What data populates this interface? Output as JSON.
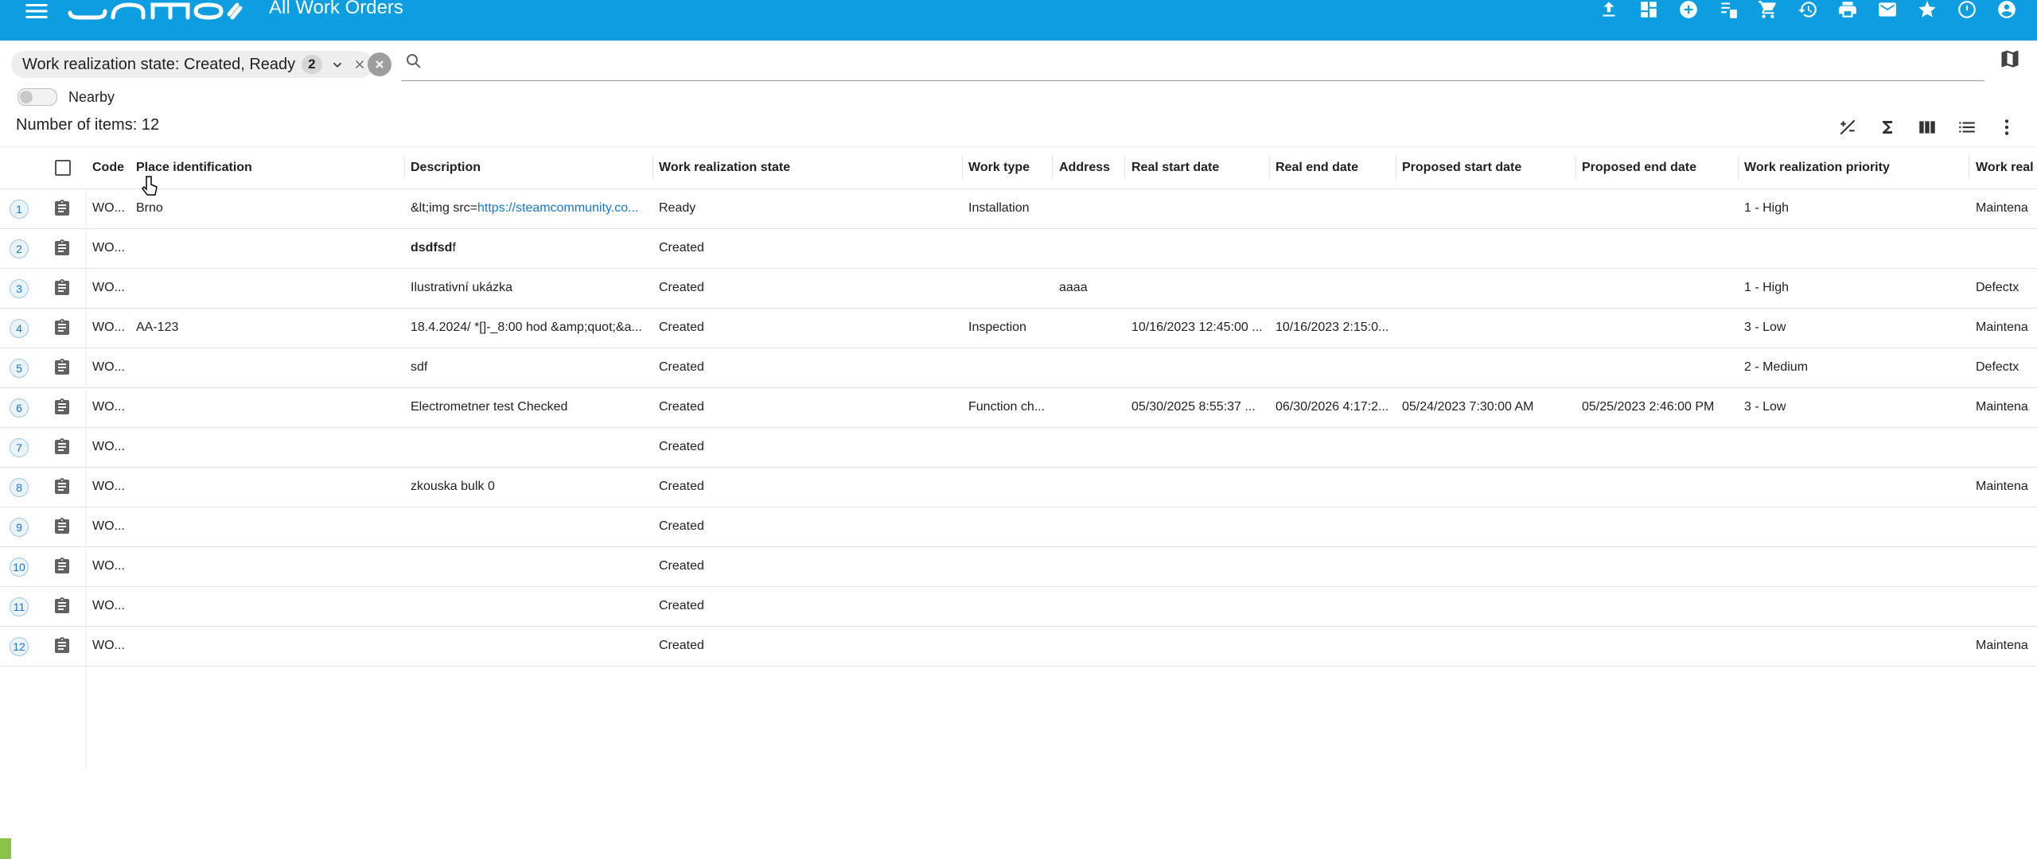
{
  "app": {
    "title": "All Work Orders",
    "logo_text": "SAMO"
  },
  "topbar_icons": [
    "upload-icon",
    "dashboard-icon",
    "add-circle-icon",
    "assignment-list-icon",
    "cart-icon",
    "history-icon",
    "print-icon",
    "mail-icon",
    "star-icon",
    "timer-icon",
    "account-icon"
  ],
  "filter": {
    "chip_label": "Work realization state: Created, Ready",
    "chip_count": "2",
    "search_placeholder": ""
  },
  "nearby_label": "Nearby",
  "items_label": "Number of items: 12",
  "toolbar_icons": [
    "plus-minus-icon",
    "sum-icon",
    "columns-icon",
    "list-icon",
    "more-vert-icon"
  ],
  "columns": {
    "code": "Code",
    "place": "Place identification",
    "description": "Description",
    "state": "Work realization state",
    "work_type": "Work type",
    "address": "Address",
    "real_start": "Real start date",
    "real_end": "Real end date",
    "proposed_start": "Proposed start date",
    "proposed_end": "Proposed end date",
    "priority": "Work realization priority",
    "work_real": "Work real"
  },
  "rows": [
    {
      "num": "1",
      "code": "WO...",
      "place": "Brno",
      "desc_pre": "&lt;img src=",
      "desc_link": "https://steamcommunity.co...",
      "desc_bold": "",
      "desc_rest": "",
      "state": "Ready",
      "work_type": "Installation",
      "address": "",
      "real_start": "",
      "real_end": "",
      "proposed_start": "",
      "proposed_end": "",
      "priority": "1 - High",
      "work_real": "Maintena"
    },
    {
      "num": "2",
      "code": "WO...",
      "place": "",
      "desc_pre": "",
      "desc_link": "",
      "desc_bold": "dsdfsd",
      "desc_rest": "f",
      "state": "Created",
      "work_type": "",
      "address": "",
      "real_start": "",
      "real_end": "",
      "proposed_start": "",
      "proposed_end": "",
      "priority": "",
      "work_real": ""
    },
    {
      "num": "3",
      "code": "WO...",
      "place": "",
      "desc_pre": "Ilustrativní ukázka",
      "desc_link": "",
      "desc_bold": "",
      "desc_rest": "",
      "state": "Created",
      "work_type": "",
      "address": "aaaa",
      "real_start": "",
      "real_end": "",
      "proposed_start": "",
      "proposed_end": "",
      "priority": "1 - High",
      "work_real": "Defectx"
    },
    {
      "num": "4",
      "code": "WO...",
      "place": "AA-123",
      "desc_pre": "18.4.2024/ *[]-_8:00 hod &amp;quot;&a...",
      "desc_link": "",
      "desc_bold": "",
      "desc_rest": "",
      "state": "Created",
      "work_type": "Inspection",
      "address": "",
      "real_start": "10/16/2023 12:45:00 ...",
      "real_end": "10/16/2023 2:15:0...",
      "proposed_start": "",
      "proposed_end": "",
      "priority": "3 - Low",
      "work_real": "Maintena"
    },
    {
      "num": "5",
      "code": "WO...",
      "place": "",
      "desc_pre": "sdf",
      "desc_link": "",
      "desc_bold": "",
      "desc_rest": "",
      "state": "Created",
      "work_type": "",
      "address": "",
      "real_start": "",
      "real_end": "",
      "proposed_start": "",
      "proposed_end": "",
      "priority": "2 - Medium",
      "work_real": "Defectx"
    },
    {
      "num": "6",
      "code": "WO...",
      "place": "",
      "desc_pre": "Electrometner test Checked",
      "desc_link": "",
      "desc_bold": "",
      "desc_rest": "",
      "state": "Created",
      "work_type": "Function ch...",
      "address": "",
      "real_start": "05/30/2025 8:55:37 ...",
      "real_end": "06/30/2026 4:17:2...",
      "proposed_start": "05/24/2023 7:30:00 AM",
      "proposed_end": "05/25/2023 2:46:00 PM",
      "priority": "3 - Low",
      "work_real": "Maintena"
    },
    {
      "num": "7",
      "code": "WO...",
      "place": "",
      "desc_pre": "",
      "desc_link": "",
      "desc_bold": "",
      "desc_rest": "",
      "state": "Created",
      "work_type": "",
      "address": "",
      "real_start": "",
      "real_end": "",
      "proposed_start": "",
      "proposed_end": "",
      "priority": "",
      "work_real": ""
    },
    {
      "num": "8",
      "code": "WO...",
      "place": "",
      "desc_pre": "zkouska bulk 0",
      "desc_link": "",
      "desc_bold": "",
      "desc_rest": "",
      "state": "Created",
      "work_type": "",
      "address": "",
      "real_start": "",
      "real_end": "",
      "proposed_start": "",
      "proposed_end": "",
      "priority": "",
      "work_real": "Maintena"
    },
    {
      "num": "9",
      "code": "WO...",
      "place": "",
      "desc_pre": "",
      "desc_link": "",
      "desc_bold": "",
      "desc_rest": "",
      "state": "Created",
      "work_type": "",
      "address": "",
      "real_start": "",
      "real_end": "",
      "proposed_start": "",
      "proposed_end": "",
      "priority": "",
      "work_real": ""
    },
    {
      "num": "10",
      "code": "WO...",
      "place": "",
      "desc_pre": "",
      "desc_link": "",
      "desc_bold": "",
      "desc_rest": "",
      "state": "Created",
      "work_type": "",
      "address": "",
      "real_start": "",
      "real_end": "",
      "proposed_start": "",
      "proposed_end": "",
      "priority": "",
      "work_real": ""
    },
    {
      "num": "11",
      "code": "WO...",
      "place": "",
      "desc_pre": "",
      "desc_link": "",
      "desc_bold": "",
      "desc_rest": "",
      "state": "Created",
      "work_type": "",
      "address": "",
      "real_start": "",
      "real_end": "",
      "proposed_start": "",
      "proposed_end": "",
      "priority": "",
      "work_real": ""
    },
    {
      "num": "12",
      "code": "WO...",
      "place": "",
      "desc_pre": "",
      "desc_link": "",
      "desc_bold": "",
      "desc_rest": "",
      "state": "Created",
      "work_type": "",
      "address": "",
      "real_start": "",
      "real_end": "",
      "proposed_start": "",
      "proposed_end": "",
      "priority": "",
      "work_real": "Maintena"
    }
  ],
  "colors": {
    "topbar": "#0c9ee0",
    "link": "#1976d2",
    "accent_green": "#8bc34a"
  }
}
